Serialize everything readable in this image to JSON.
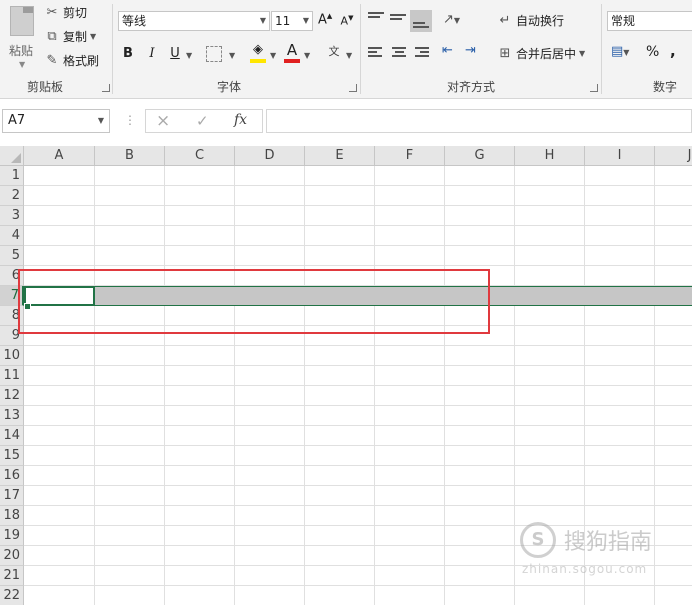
{
  "ribbon": {
    "clipboard": {
      "paste_label": "粘贴",
      "cut_label": "剪切",
      "copy_label": "复制",
      "format_painter_label": "格式刷",
      "group_label": "剪贴板"
    },
    "font": {
      "font_name": "等线",
      "font_size": "11",
      "bold": "B",
      "italic": "I",
      "underline": "U",
      "group_label": "字体",
      "font_color": "#e02020",
      "highlight_color": "#ffe600"
    },
    "alignment": {
      "wrap_text_label": "自动换行",
      "merge_center_label": "合并后居中",
      "group_label": "对齐方式"
    },
    "number": {
      "format_value": "常规",
      "percent": "%",
      "comma": ",",
      "group_label": "数字"
    }
  },
  "formula_bar": {
    "name_box_value": "A7",
    "cancel_icon": "×",
    "enter_icon": "✓",
    "fx_label": "fx",
    "formula_value": ""
  },
  "grid": {
    "columns": [
      "A",
      "B",
      "C",
      "D",
      "E",
      "F",
      "G",
      "H",
      "I",
      "J"
    ],
    "rows": [
      "1",
      "2",
      "3",
      "4",
      "5",
      "6",
      "7",
      "8",
      "9",
      "10",
      "11",
      "12",
      "13",
      "14",
      "15",
      "16",
      "17",
      "18",
      "19",
      "20",
      "21",
      "22"
    ],
    "selected_row": "7",
    "active_cell": "A7"
  },
  "watermark": {
    "logo_glyph": "S",
    "text": "搜狗指南",
    "url": "zhinan.sogou.com"
  },
  "colors": {
    "accent_green": "#217346",
    "annotation_red": "#e0393e"
  }
}
